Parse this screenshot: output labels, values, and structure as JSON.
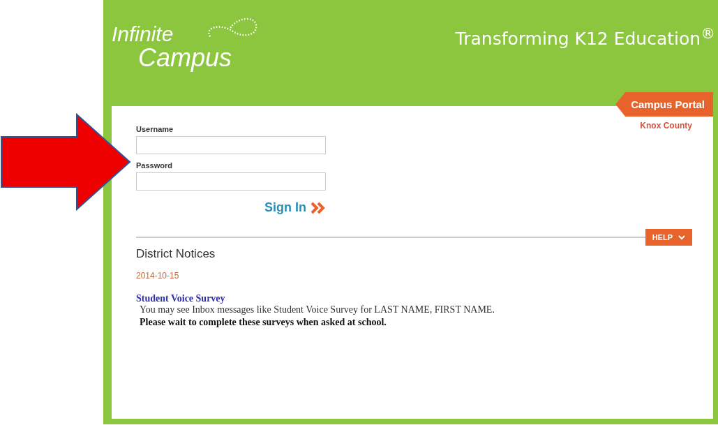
{
  "header": {
    "logo_line_1": "Infinite",
    "logo_line_2": "Campus",
    "tagline": "Transforming K12 Education$^{®}$"
  },
  "portal_tab": {
    "label": "Campus Portal"
  },
  "district": "Knox County",
  "login": {
    "fields": [
      {
        "label": "Username"
      },
      {
        "label": "Password"
      }
    ],
    "sign_in": "Sign In"
  },
  "help": {
    "label": "HELP"
  },
  "notices": {
    "title": "District Notices",
    "items": [
      {
        "date": "2014-10-15",
        "title": "Student Voice Survey",
        "body": "You may see Inbox messages like Student Voice Survey for LAST NAME, FIRST NAME.",
        "note": "Please wait to complete these surveys when asked at school."
      }
    ]
  }
}
